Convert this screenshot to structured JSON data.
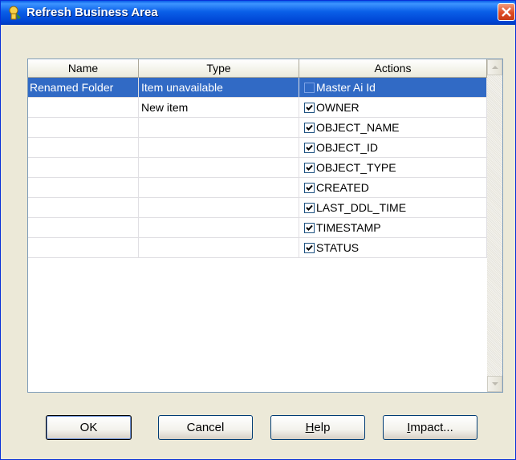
{
  "window": {
    "title": "Refresh Business Area"
  },
  "columns": {
    "name": "Name",
    "type": "Type",
    "actions": "Actions"
  },
  "rows": [
    {
      "name": "Renamed Folder",
      "type": "Item unavailable",
      "action": "Master Ai Id",
      "checked": false,
      "selected": true
    },
    {
      "name": "",
      "type": "New item",
      "action": "OWNER",
      "checked": true,
      "selected": false
    },
    {
      "name": "",
      "type": "",
      "action": "OBJECT_NAME",
      "checked": true,
      "selected": false
    },
    {
      "name": "",
      "type": "",
      "action": "OBJECT_ID",
      "checked": true,
      "selected": false
    },
    {
      "name": "",
      "type": "",
      "action": "OBJECT_TYPE",
      "checked": true,
      "selected": false
    },
    {
      "name": "",
      "type": "",
      "action": "CREATED",
      "checked": true,
      "selected": false
    },
    {
      "name": "",
      "type": "",
      "action": "LAST_DDL_TIME",
      "checked": true,
      "selected": false
    },
    {
      "name": "",
      "type": "",
      "action": "TIMESTAMP",
      "checked": true,
      "selected": false
    },
    {
      "name": "",
      "type": "",
      "action": "STATUS",
      "checked": true,
      "selected": false
    }
  ],
  "buttons": {
    "ok": "OK",
    "cancel": "Cancel",
    "help_mnemonic": "H",
    "help_rest": "elp",
    "impact_mnemonic": "I",
    "impact_rest": "mpact..."
  },
  "icons": {
    "title": "business-area-icon",
    "close": "close-icon",
    "scroll_up": "arrow-up-icon",
    "scroll_down": "arrow-down-icon",
    "check": "checkmark-icon"
  },
  "colors": {
    "titlebar": "#0a5fe8",
    "selection": "#316ac5",
    "dialog_bg": "#ece9d8",
    "close_button": "#de4a23"
  }
}
